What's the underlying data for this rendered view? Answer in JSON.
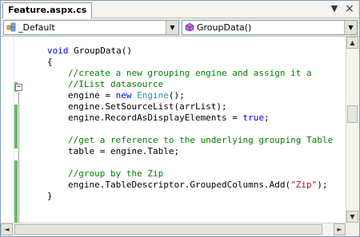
{
  "tab": {
    "title": "Feature.aspx.cs",
    "dropdown_glyph": "▼",
    "close_glyph": "×"
  },
  "nav": {
    "left_combo": {
      "value": "_Default",
      "icon": "class-icon"
    },
    "right_combo": {
      "value": "GroupData()",
      "icon": "method-icon"
    },
    "dropdown_glyph": "▼"
  },
  "code": {
    "l1_kw": "void",
    "l1_rest": " GroupData()",
    "l2": "{",
    "l3": "//create a new grouping engine and assign it a",
    "l4": "//IList datasource",
    "l5_a": "engine = ",
    "l5_kw": "new",
    "l5_b": " ",
    "l5_ty": "Engine",
    "l5_c": "();",
    "l6": "engine.SetSourceList(arrList);",
    "l7_a": "engine.RecordAsDisplayElements = ",
    "l7_kw": "true",
    "l7_b": ";",
    "l9": "//get a reference to the underlying grouping Table",
    "l10": "table = engine.Table;",
    "l12": "//group by the Zip",
    "l13_a": "engine.TableDescriptor.GroupedColumns.Add(",
    "l13_st": "\"Zip\"",
    "l13_b": ");",
    "l14": "}"
  },
  "scroll": {
    "up": "▲",
    "down": "▼",
    "left": "◄",
    "right": "►"
  },
  "colors": {
    "keyword": "#0000ff",
    "comment": "#008000",
    "type": "#2b91af",
    "string": "#a31515",
    "changed_bar": "#5fbf5f"
  }
}
